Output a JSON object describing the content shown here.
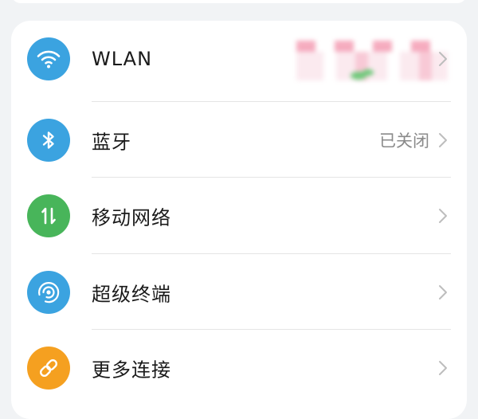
{
  "colors": {
    "wlan_icon_bg": "#3ba3e0",
    "bluetooth_icon_bg": "#3ba3e0",
    "mobile_network_icon_bg": "#48b55a",
    "super_device_icon_bg": "#3ba3e0",
    "more_connections_icon_bg": "#f5a020",
    "chevron": "#bdbdbd",
    "status_text": "#8a8a8a"
  },
  "settings": {
    "items": [
      {
        "id": "wlan",
        "label": "WLAN",
        "icon": "wifi-icon",
        "status": ""
      },
      {
        "id": "bluetooth",
        "label": "蓝牙",
        "icon": "bluetooth-icon",
        "status": "已关闭"
      },
      {
        "id": "mobile_network",
        "label": "移动网络",
        "icon": "mobile-data-icon",
        "status": ""
      },
      {
        "id": "super_device",
        "label": "超级终端",
        "icon": "super-device-icon",
        "status": ""
      },
      {
        "id": "more_connections",
        "label": "更多连接",
        "icon": "link-icon",
        "status": ""
      }
    ]
  }
}
